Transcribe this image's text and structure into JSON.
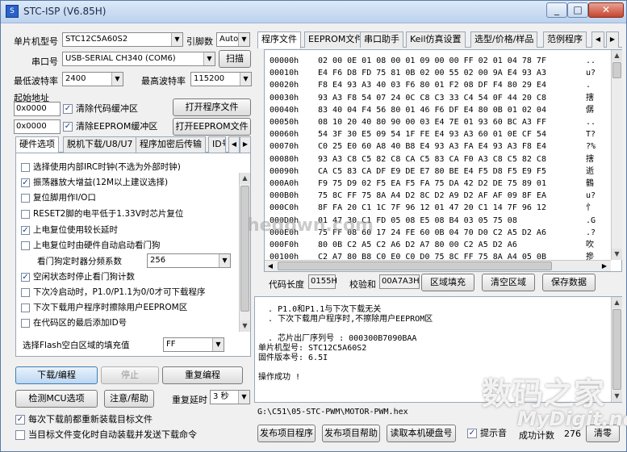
{
  "window": {
    "title": "STC-ISP (V6.85H)",
    "minimize": "_",
    "maximize": "□",
    "close": "✕"
  },
  "left": {
    "mcu_label": "单片机型号",
    "mcu_value": "STC12C5A60S2",
    "pin_label": "引脚数",
    "pin_value": "Auto",
    "port_label": "串口号",
    "port_value": "USB-SERIAL CH340 (COM6)",
    "scan_button": "扫描",
    "min_baud_label": "最低波特率",
    "min_baud_value": "2400",
    "max_baud_label": "最高波特率",
    "max_baud_value": "115200",
    "start_addr_label": "起始地址",
    "addr1": "0x0000",
    "clear_code": "清除代码缓冲区",
    "open_program": "打开程序文件",
    "addr2": "0x0000",
    "clear_eeprom": "清除EEPROM缓冲区",
    "open_eeprom": "打开EEPROM文件"
  },
  "hw_tabs": [
    "硬件选项",
    "脱机下载/U8/U7",
    "程序加密后传输",
    "ID号"
  ],
  "hw_options": [
    {
      "label": "选择使用内部IRC时钟(不选为外部时钟)",
      "checked": false
    },
    {
      "label": "振荡器放大增益(12M以上建议选择)",
      "checked": true
    },
    {
      "label": "复位脚用作I/O口",
      "checked": false
    },
    {
      "label": "RESET2脚的电平低于1.33V时芯片复位",
      "checked": false
    },
    {
      "label": "上电复位使用较长延时",
      "checked": true
    },
    {
      "label": "上电复位时由硬件自动启动看门狗",
      "checked": false
    }
  ],
  "wdt_label": "看门狗定时器分频系数",
  "wdt_value": "256",
  "hw_options2": [
    {
      "label": "空闲状态时停止看门狗计数",
      "checked": true
    },
    {
      "label": "下次冷启动时，P1.0/P1.1为0/0才可下载程序",
      "checked": false
    },
    {
      "label": "下次下载用户程序时擦除用户EEPROM区",
      "checked": false
    },
    {
      "label": "在代码区的最后添加ID号",
      "checked": false
    }
  ],
  "fill_label": "选择Flash空白区域的填充值",
  "fill_value": "FF",
  "actions": {
    "download": "下载/编程",
    "stop": "停止",
    "reprogram": "重复编程",
    "detect": "检测MCU选项",
    "help": "注意/帮助",
    "repeat_delay_label": "重复延时",
    "repeat_delay_value": "3 秒",
    "reload_each": "每次下载前都重新装载目标文件",
    "auto_reload": "当目标文件变化时自动装载并发送下载命令"
  },
  "main_tabs": [
    "程序文件",
    "EEPROM文件",
    "串口助手",
    "Keil仿真设置",
    "选型/价格/样品",
    "范例程序"
  ],
  "hex_rows": [
    {
      "addr": "00000h",
      "bytes": "02 00 0E 01 08 00 01 09 00 00 FF 02 01 04 78 7F",
      "ascii": ".."
    },
    {
      "addr": "00010h",
      "bytes": "E4 F6 D8 FD 75 81 0B 02 00 55 02 00 9A E4 93 A3",
      "ascii": "u?"
    },
    {
      "addr": "00020h",
      "bytes": "F8 E4 93 A3 40 03 F6 80 01 F2 08 DF F4 80 29 E4",
      "ascii": "."
    },
    {
      "addr": "00030h",
      "bytes": "93 A3 F8 54 07 24 0C C8 C3 33 C4 54 0F 44 20 C8",
      "ascii": "搳"
    },
    {
      "addr": "00040h",
      "bytes": "83 40 04 F4 56 80 01 46 F6 DF E4 80 0B 01 02 04",
      "ascii": "僝"
    },
    {
      "addr": "00050h",
      "bytes": "08 10 20 40 80 90 00 03 E4 7E 01 93 60 BC A3 FF",
      "ascii": ".."
    },
    {
      "addr": "00060h",
      "bytes": "54 3F 30 E5 09 54 1F FE E4 93 A3 60 01 0E CF 54",
      "ascii": "T?"
    },
    {
      "addr": "00070h",
      "bytes": "C0 25 E0 60 A8 40 B8 E4 93 A3 FA E4 93 A3 F8 E4",
      "ascii": "?%"
    },
    {
      "addr": "00080h",
      "bytes": "93 A3 C8 C5 82 C8 CA C5 83 CA F0 A3 C8 C5 82 C8",
      "ascii": "搳"
    },
    {
      "addr": "00090h",
      "bytes": "CA C5 83 CA DF E9 DE E7 80 BE E4 F5 D8 F5 E9 F5",
      "ascii": "逝"
    },
    {
      "addr": "000A0h",
      "bytes": "F9 75 D9 02 F5 EA F5 FA 75 DA 42 D2 DE 75 89 01",
      "ascii": "鶴"
    },
    {
      "addr": "000B0h",
      "bytes": "75 8C FF 75 8A A4 D2 8C D2 A9 D2 AF AF 09 8F EA",
      "ascii": "u?"
    },
    {
      "addr": "000C0h",
      "bytes": "8F FA 20 C1 1C 7F 96 12 01 47 20 C1 14 7F 96 12",
      "ascii": "忄"
    },
    {
      "addr": "000D0h",
      "bytes": "01 47 30 C1 FD 05 08 E5 08 B4 03 05 75 08",
      "ascii": ".G"
    },
    {
      "addr": "000E0h",
      "bytes": "75 FF 08 60 17 24 FE 60 0B 04 70 D0 C2 A5 D2 A6",
      "ascii": ".?"
    },
    {
      "addr": "000F0h",
      "bytes": "80 0B C2 A5 C2 A6 D2 A7 80 00 C2 A5 D2 A6",
      "ascii": "吹"
    },
    {
      "addr": "00100h",
      "bytes": "C2 A7 80 B8 C0 E0 C0 D0 75 8C FF 75 8A A4 05 0B",
      "ascii": "摻"
    }
  ],
  "code_bar": {
    "length_label": "代码长度",
    "length_value": "0155H",
    "checksum_label": "校验和",
    "checksum_value": "00A7A3H",
    "fill_button": "区域填充",
    "clear_button": "清空区域",
    "save_button": "保存数据"
  },
  "log_lines": [
    "  . P1.0和P1.1与下次下载无关",
    "  . 下次下载用户程序时,不擦除用户EEPROM区",
    "",
    "  . 芯片出厂序列号 : 000300B7090BAA",
    "单片机型号: STC12C5A60S2",
    "固件版本号: 6.5I",
    "",
    "操作成功 !"
  ],
  "file_path": "G:\\C51\\05-STC-PWM\\MOTOR-PWM.hex",
  "bottom": {
    "publish_program": "发布项目程序",
    "publish_help": "发布项目帮助",
    "read_disk": "读取本机硬盘号",
    "beep": "提示音",
    "success_label": "成功计数",
    "success_value": "276",
    "clear": "清零"
  },
  "watermarks": {
    "center": "hedown.com",
    "logo": "数码之家",
    "url": "MyDigit.net"
  }
}
